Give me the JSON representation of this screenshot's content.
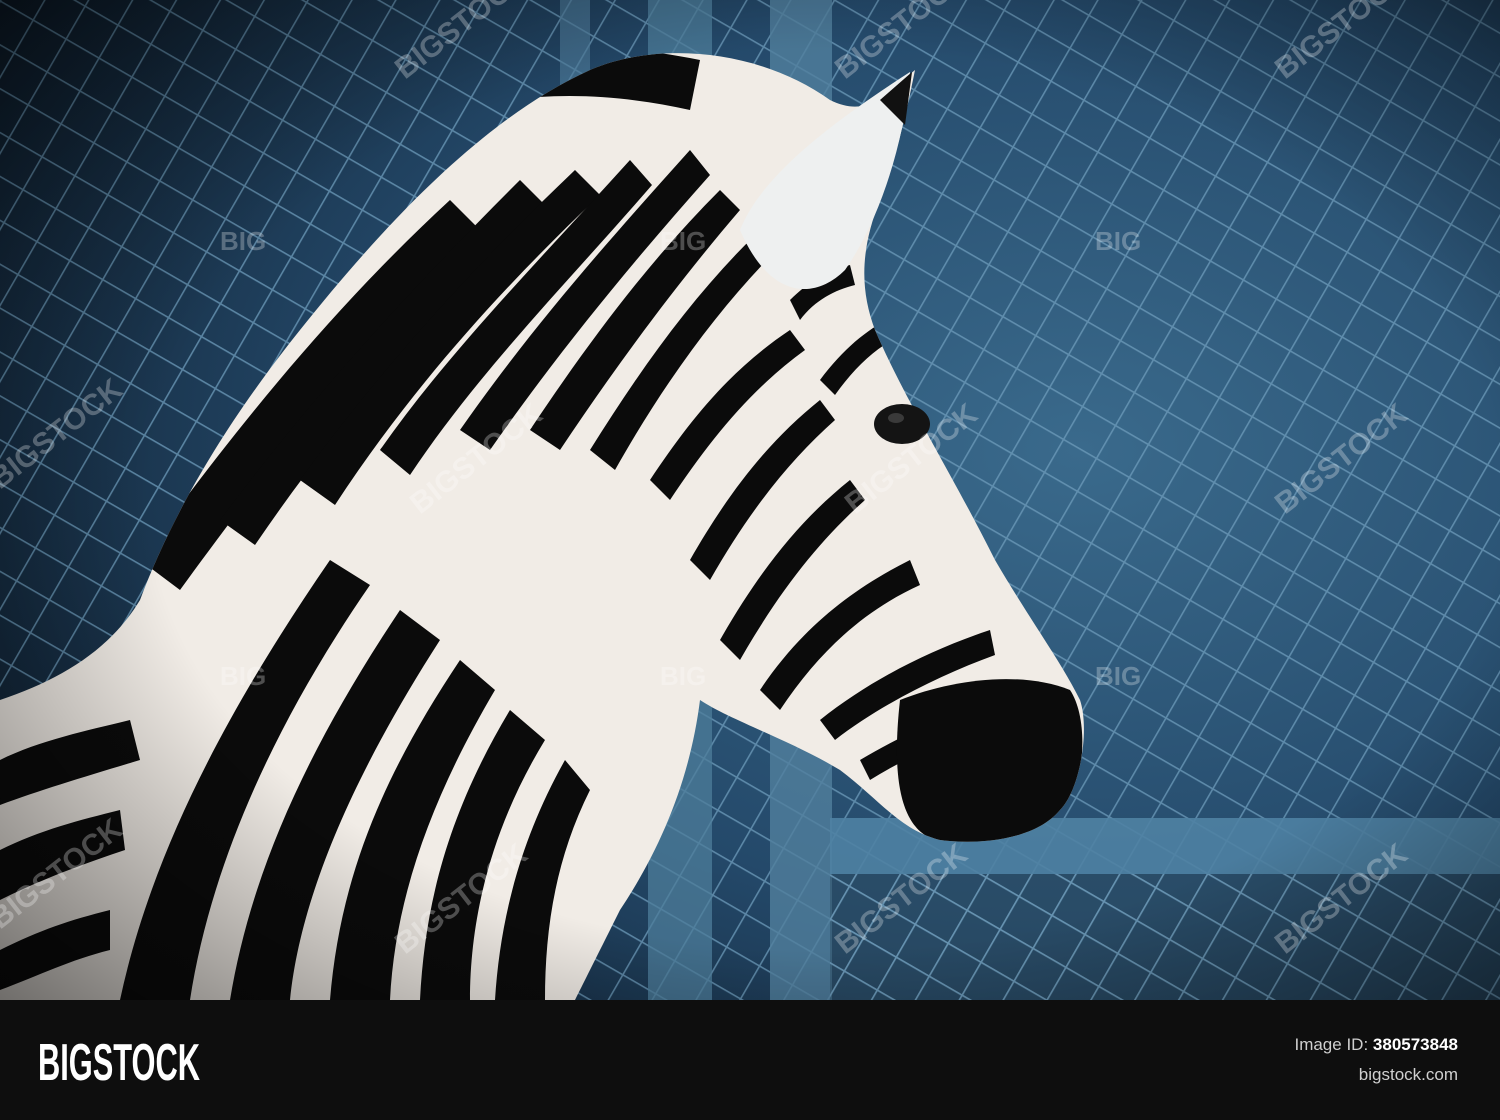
{
  "watermark": {
    "text_short": "BIG",
    "text_long": "BIGSTOCK"
  },
  "footer": {
    "brand": "BIGSTOCK",
    "image_id_label": "Image ID:",
    "image_id_value": "380573848",
    "site": "bigstock.com"
  },
  "colors": {
    "fence": "#5d8fae",
    "background": "#1f3f5a",
    "footer_bg": "#0e0e0e",
    "zebra_black": "#0b0b0b",
    "zebra_white": "#f1ece6"
  }
}
